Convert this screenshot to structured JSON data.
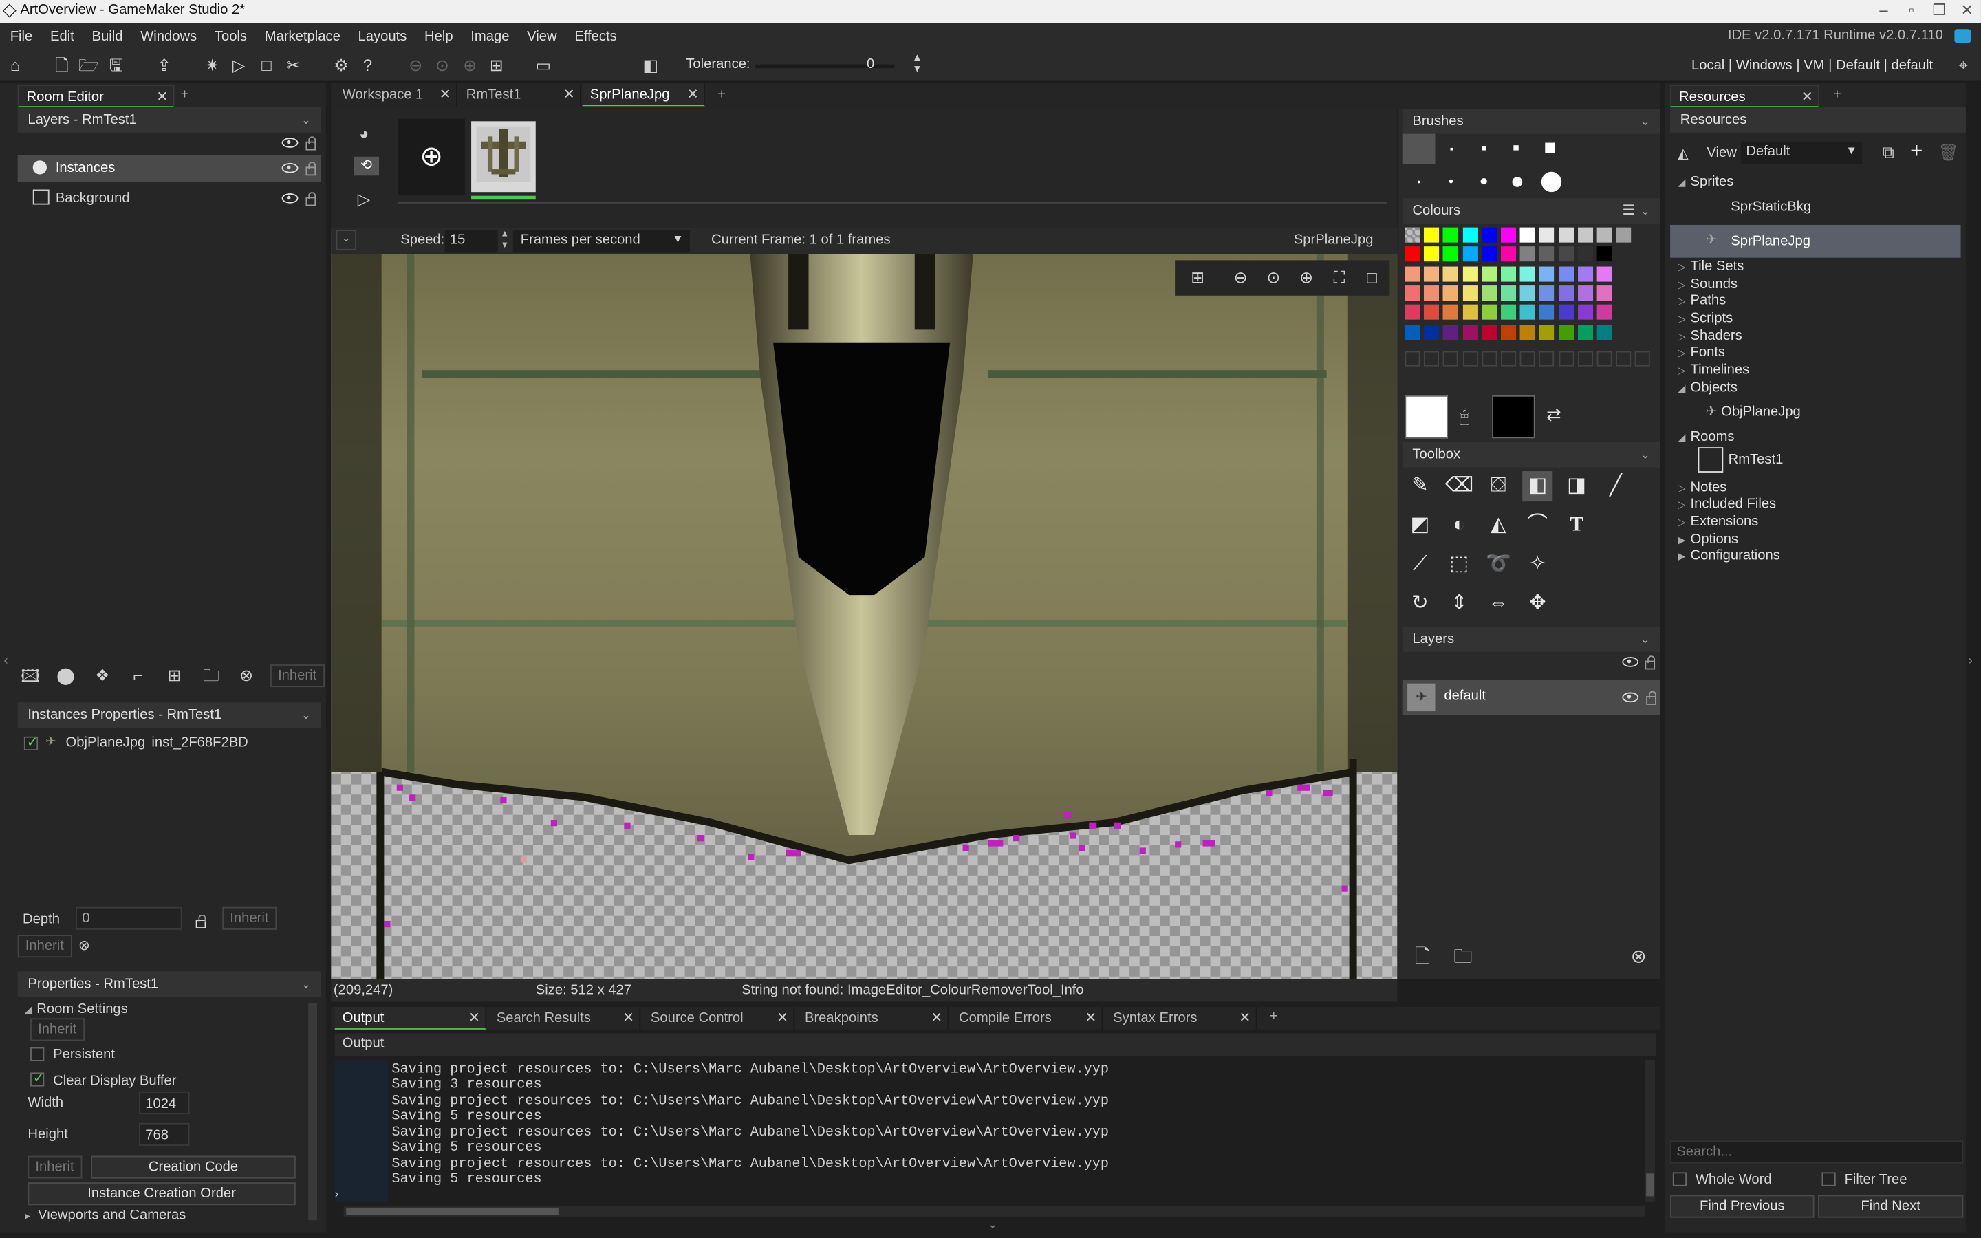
{
  "window": {
    "title": "ArtOverview - GameMaker Studio 2*"
  },
  "menu": {
    "items": [
      "File",
      "Edit",
      "Build",
      "Windows",
      "Tools",
      "Marketplace",
      "Layouts",
      "Help",
      "Image",
      "View",
      "Effects"
    ],
    "ide_version": "IDE v2.0.7.171 Runtime v2.0.7.110"
  },
  "toolbar": {
    "tolerance_label": "Tolerance:",
    "tolerance_value": "0",
    "target": "Local | Windows | VM | Default | default"
  },
  "left": {
    "tab_label": "Room Editor",
    "layers_header": "Layers - RmTest1",
    "layers": [
      {
        "name": "Instances",
        "selected": true
      },
      {
        "name": "Background",
        "selected": false
      }
    ],
    "inherit_label": "Inherit",
    "instances_header": "Instances Properties - RmTest1",
    "instance": {
      "object": "ObjPlaneJpg",
      "id": "inst_2F68F2BD"
    },
    "depth_label": "Depth",
    "depth_value": "0",
    "properties_header": "Properties - RmTest1",
    "room_settings": "Room Settings",
    "persistent_label": "Persistent",
    "clear_buffer_label": "Clear Display Buffer",
    "width_label": "Width",
    "width_value": "1024",
    "height_label": "Height",
    "height_value": "768",
    "creation_code": "Creation Code",
    "instance_creation_order": "Instance Creation Order",
    "viewports": "Viewports and Cameras"
  },
  "editor": {
    "tabs": [
      {
        "label": "Workspace 1",
        "active": false
      },
      {
        "label": "RmTest1",
        "active": false
      },
      {
        "label": "SprPlaneJpg",
        "active": true
      }
    ],
    "speed_label": "Speed:",
    "speed_value": "15",
    "speed_unit": "Frames per second",
    "current_frame": "Current Frame: 1 of 1 frames",
    "sprite_name": "SprPlaneJpg",
    "status_coords": "(209,247)",
    "status_size": "Size: 512 x 427",
    "status_message": "String not found: ImageEditor_ColourRemoverTool_Info"
  },
  "image_panels": {
    "brushes": "Brushes",
    "colours": "Colours",
    "toolbox": "Toolbox",
    "layers": "Layers",
    "layer_name": "default"
  },
  "palette": [
    [
      "#ffff00",
      "#00ff00",
      "#00ffff",
      "#0000ff",
      "#ff00ff",
      "#ffffff",
      "#e8e8e8",
      "#d8d8d8",
      "#c8c8c8",
      "#b8b8b8",
      "#a0a0a0"
    ],
    [
      "#ff0000",
      "#ffff00",
      "#00ff00",
      "#00aaff",
      "#0000ff",
      "#ff00aa",
      "#808080",
      "#606060",
      "#484848",
      "#303030",
      "#000000"
    ],
    [
      "#f29a7a",
      "#f2b27a",
      "#f2d27a",
      "#f2f27a",
      "#b2f27a",
      "#7af2a2",
      "#7af2e2",
      "#7ab2f2",
      "#7a8af2",
      "#a27af2",
      "#e27af2"
    ],
    [
      "#f07070",
      "#f08e70",
      "#f0b070",
      "#f0e070",
      "#a0e070",
      "#70e0a0",
      "#70d0e0",
      "#7090e0",
      "#8070e0",
      "#b070e0",
      "#e070c0"
    ],
    [
      "#e03a60",
      "#e04a3a",
      "#e07a3a",
      "#e0c03a",
      "#8ad03a",
      "#3ad07a",
      "#3ac0d0",
      "#3a7ad0",
      "#4a3ad0",
      "#8a3ad0",
      "#d03aa0"
    ],
    [
      "#0060c0",
      "#0030a0",
      "#602080",
      "#a01060",
      "#c00030",
      "#c04000",
      "#c08000",
      "#a0a000",
      "#40a000",
      "#00a060",
      "#008080"
    ]
  ],
  "output": {
    "tabs": [
      "Output",
      "Search Results",
      "Source Control",
      "Breakpoints",
      "Compile Errors",
      "Syntax Errors"
    ],
    "title": "Output",
    "lines": [
      "Saving project resources to: C:\\Users\\Marc Aubanel\\Desktop\\ArtOverview\\ArtOverview.yyp",
      "Saving 3 resources",
      "Saving project resources to: C:\\Users\\Marc Aubanel\\Desktop\\ArtOverview\\ArtOverview.yyp",
      "Saving 5 resources",
      "Saving project resources to: C:\\Users\\Marc Aubanel\\Desktop\\ArtOverview\\ArtOverview.yyp",
      "Saving 5 resources",
      "Saving project resources to: C:\\Users\\Marc Aubanel\\Desktop\\ArtOverview\\ArtOverview.yyp",
      "Saving 5 resources"
    ]
  },
  "resources": {
    "tab_label": "Resources",
    "header": "Resources",
    "view_label": "View",
    "view_value": "Default",
    "sprites": "Sprites",
    "sprite_items": [
      "SprStaticBkg",
      "SprPlaneJpg"
    ],
    "tile_sets": "Tile Sets",
    "sounds": "Sounds",
    "paths": "Paths",
    "scripts": "Scripts",
    "shaders": "Shaders",
    "fonts": "Fonts",
    "timelines": "Timelines",
    "objects": "Objects",
    "object_item": "ObjPlaneJpg",
    "rooms": "Rooms",
    "room_item": "RmTest1",
    "notes": "Notes",
    "included_files": "Included Files",
    "extensions": "Extensions",
    "options": "Options",
    "configurations": "Configurations",
    "search_placeholder": "Search...",
    "whole_word": "Whole Word",
    "filter_tree": "Filter Tree",
    "find_previous": "Find Previous",
    "find_next": "Find Next"
  }
}
